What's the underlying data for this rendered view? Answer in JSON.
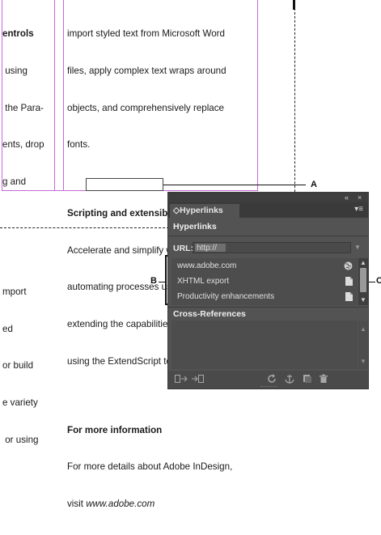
{
  "document": {
    "left_column_lines": [
      "entrols",
      " using",
      " the Para-",
      "ents, drop",
      "g and",
      "",
      "",
      "mport",
      "ed",
      "or build",
      "e variety",
      " or using"
    ],
    "right_column": {
      "intro_lines": [
        "import styled text from Microsoft Word",
        "files, apply complex text wraps around",
        "objects, and comprehensively replace",
        "fonts."
      ],
      "heading1": "Scripting and extensibility",
      "body1_lines": [
        "Accelerate and simplify workflows by",
        "automating processes using scripts and",
        "extending the capabilities of InDesign",
        "using the ExtendScript toolkit."
      ],
      "heading2": "For more information",
      "body2_line": "For more details about Adobe InDesign,",
      "visit_prefix": "visit ",
      "link_text": "www.adobe.com"
    }
  },
  "callouts": {
    "a": "A",
    "b": "B",
    "c": "C"
  },
  "panel": {
    "collapse_glyph": "«",
    "close_glyph": "×",
    "tab_label": "◇Hyperlinks",
    "menu_glyph": "▾≡",
    "hyperlinks_title": "Hyperlinks",
    "url_label": "URL:",
    "url_value": "http://",
    "url_dropdown": "▼",
    "items": [
      {
        "label": "www.adobe.com",
        "icon": "globe-icon"
      },
      {
        "label": "XHTML export",
        "icon": "page-icon"
      },
      {
        "label": "Productivity enhancements",
        "icon": "page-icon"
      }
    ],
    "cross_refs_title": "Cross-References",
    "scroll_up": "▲",
    "scroll_down": "▼",
    "bottom_icons": [
      "go-to-source-icon",
      "go-to-destination-icon",
      "refresh-icon",
      "anchor-icon",
      "new-icon",
      "delete-icon"
    ]
  },
  "colors": {
    "panel_bg": "#535353",
    "guide": "#c36ad6"
  }
}
